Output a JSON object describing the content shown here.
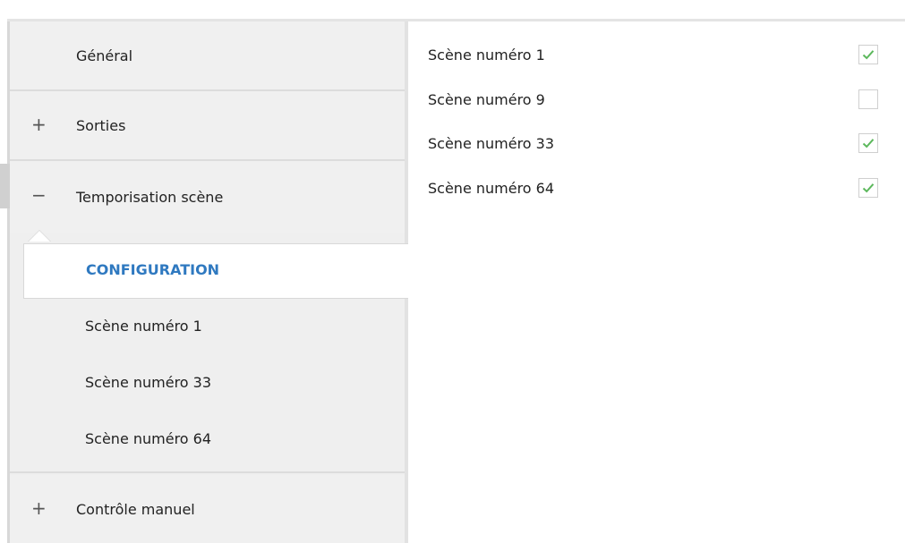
{
  "sidebar": {
    "general_label": "Général",
    "sorties": {
      "sign": "+",
      "label": "Sorties"
    },
    "temporisation": {
      "sign": "−",
      "label": "Temporisation scène"
    },
    "configuration_label": "CONFIGURATION",
    "sub_items": [
      {
        "label": "Scène numéro 1"
      },
      {
        "label": "Scène numéro 33"
      },
      {
        "label": "Scène numéro 64"
      }
    ],
    "controle": {
      "sign": "+",
      "label": "Contrôle manuel"
    }
  },
  "params": [
    {
      "label": "Scène numéro 1",
      "checked": true
    },
    {
      "label": "Scène numéro 9",
      "checked": false
    },
    {
      "label": "Scène numéro 33",
      "checked": true
    },
    {
      "label": "Scène numéro 64",
      "checked": true
    }
  ],
  "colors": {
    "accent": "#2f79c0",
    "check": "#5cb85c",
    "sidebar_bg": "#f0f0f0"
  }
}
